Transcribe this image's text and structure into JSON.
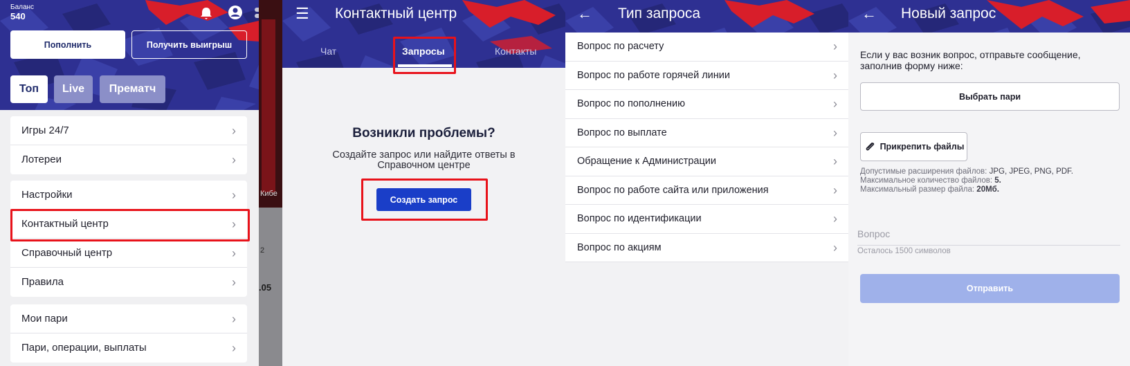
{
  "menu": {
    "balance_label": "Баланс",
    "balance_value": "540",
    "deposit_button": "Пополнить",
    "withdraw_button": "Получить выигрыш",
    "filters": [
      "Топ",
      "Live",
      "Прематч"
    ],
    "group1": [
      "Игры 24/7",
      "Лотереи"
    ],
    "group2": [
      "Настройки",
      "Контактный центр",
      "Справочный центр",
      "Правила"
    ],
    "group3": [
      "Мои пари",
      "Пари, операции, выплаты"
    ]
  },
  "behind": {
    "category": "Кибе",
    "number1": "2",
    "number2": ".05"
  },
  "contact_center": {
    "title": "Контактный центр",
    "tabs": [
      "Чат",
      "Запросы",
      "Контакты"
    ],
    "heading": "Возникли проблемы?",
    "description_line1": "Создайте запрос или найдите ответы в",
    "description_line2": "Справочном центре",
    "create_button": "Создать запрос"
  },
  "request_type": {
    "title": "Тип запроса",
    "items": [
      "Вопрос по расчету",
      "Вопрос по работе горячей линии",
      "Вопрос по пополнению",
      "Вопрос по выплате",
      "Обращение к Администрации",
      "Вопрос по работе сайта или приложения",
      "Вопрос по идентификации",
      "Вопрос по акциям"
    ]
  },
  "new_request": {
    "title": "Новый запрос",
    "intro_line1": "Если у вас возник вопрос, отправьте сообщение,",
    "intro_line2": "заполнив форму ниже:",
    "choose_bets_button": "Выбрать пари",
    "attach_button": "Прикрепить файлы",
    "hint_ext_label": "Допустимые расширения файлов:",
    "hint_ext_value": "JPG, JPEG, PNG, PDF.",
    "hint_count_label": "Максимальное количество файлов:",
    "hint_count_value": "5.",
    "hint_size_label": "Максимальный размер файла:",
    "hint_size_value": "20Мб.",
    "question_placeholder": "Вопрос",
    "chars_left": "Осталось 1500 символов",
    "send_button": "Отправить"
  },
  "colors": {
    "brand_blue": "#2e3092",
    "primary_button": "#1a3ec8",
    "disabled_button": "#9fb1ea",
    "highlight_red": "#e8121a"
  },
  "icons": [
    "bell-icon",
    "user-icon",
    "toggle-icon",
    "hamburger-icon",
    "back-arrow-icon",
    "chevron-right-icon",
    "paperclip-icon"
  ]
}
